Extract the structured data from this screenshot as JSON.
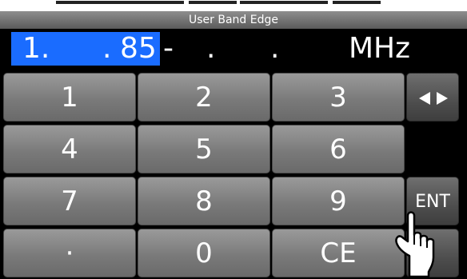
{
  "title": "User Band Edge",
  "frequency": {
    "digit_1": "1.",
    "dot_1": ".",
    "digit_2": "85",
    "dash": "-",
    "dot_2": ".",
    "dot_3": ".",
    "unit": "MHz"
  },
  "keypad": {
    "rows": [
      [
        "1",
        "2",
        "3"
      ],
      [
        "4",
        "5",
        "6"
      ],
      [
        "7",
        "8",
        "9"
      ],
      [
        "·",
        "0",
        "CE"
      ]
    ]
  },
  "side_keys": {
    "arrows_icon": "left-right-arrows-icon",
    "ent_label": "ENT"
  },
  "colors": {
    "highlight": "#1a6cff",
    "key_gray": "#7a7a7a",
    "background": "#000000"
  }
}
